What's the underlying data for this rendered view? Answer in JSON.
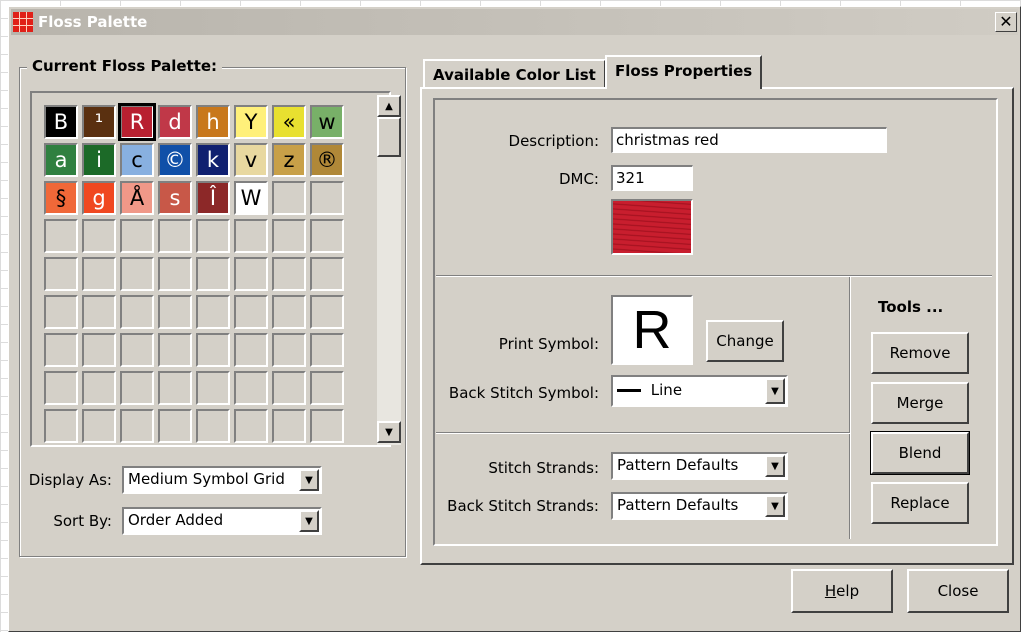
{
  "window": {
    "title": "Floss Palette",
    "close_glyph": "✕"
  },
  "palette_group": {
    "label": "Current Floss Palette:",
    "cells": [
      {
        "symbol": "B",
        "bg": "#000000",
        "fg": "#ffffff"
      },
      {
        "symbol": "¹",
        "bg": "#5a3010",
        "fg": "#ffffff"
      },
      {
        "symbol": "R",
        "bg": "#b82030",
        "fg": "#ffffff",
        "selected": true
      },
      {
        "symbol": "d",
        "bg": "#c03848",
        "fg": "#ffffff"
      },
      {
        "symbol": "h",
        "bg": "#c8781c",
        "fg": "#ffffff"
      },
      {
        "symbol": "Y",
        "bg": "#fff07a",
        "fg": "#000000"
      },
      {
        "symbol": "«",
        "bg": "#e8e030",
        "fg": "#000000"
      },
      {
        "symbol": "w",
        "bg": "#78b068",
        "fg": "#000000"
      },
      {
        "symbol": "a",
        "bg": "#308040",
        "fg": "#ffffff"
      },
      {
        "symbol": "i",
        "bg": "#1c6a28",
        "fg": "#ffffff"
      },
      {
        "symbol": "c",
        "bg": "#88b0e0",
        "fg": "#000000"
      },
      {
        "symbol": "©",
        "bg": "#1050a8",
        "fg": "#ffffff"
      },
      {
        "symbol": "k",
        "bg": "#102070",
        "fg": "#ffffff"
      },
      {
        "symbol": "v",
        "bg": "#e8d8a0",
        "fg": "#000000"
      },
      {
        "symbol": "z",
        "bg": "#c8a048",
        "fg": "#000000"
      },
      {
        "symbol": "®",
        "bg": "#b08838",
        "fg": "#000000"
      },
      {
        "symbol": "§",
        "bg": "#f06838",
        "fg": "#000000"
      },
      {
        "symbol": "g",
        "bg": "#f04820",
        "fg": "#ffffff"
      },
      {
        "symbol": "Å",
        "bg": "#f09888",
        "fg": "#000000"
      },
      {
        "symbol": "s",
        "bg": "#c85848",
        "fg": "#ffffff"
      },
      {
        "symbol": "Î",
        "bg": "#8c2828",
        "fg": "#ffffff"
      },
      {
        "symbol": "W",
        "bg": "#ffffff",
        "fg": "#000000"
      }
    ],
    "display_as": {
      "label": "Display As:",
      "value": "Medium Symbol Grid"
    },
    "sort_by": {
      "label": "Sort By:",
      "value": "Order Added"
    }
  },
  "tabs": [
    {
      "label": "Available Color List",
      "active": false
    },
    {
      "label": "Floss Properties",
      "active": true
    }
  ],
  "properties": {
    "description_label": "Description:",
    "description_value": "christmas red",
    "dmc_label": "DMC:",
    "dmc_value": "321",
    "swatch_color": "#c81e2e",
    "print_symbol_label": "Print Symbol:",
    "print_symbol_value": "R",
    "change_button": "Change",
    "back_stitch_symbol_label": "Back Stitch Symbol:",
    "back_stitch_symbol_value": "Line",
    "stitch_strands_label": "Stitch Strands:",
    "stitch_strands_value": "Pattern Defaults",
    "back_stitch_strands_label": "Back Stitch Strands:",
    "back_stitch_strands_value": "Pattern Defaults"
  },
  "tools": {
    "title": "Tools ...",
    "remove": "Remove",
    "merge": "Merge",
    "blend": "Blend",
    "replace": "Replace"
  },
  "footer": {
    "help_first": "H",
    "help_rest": "elp",
    "close": "Close"
  }
}
